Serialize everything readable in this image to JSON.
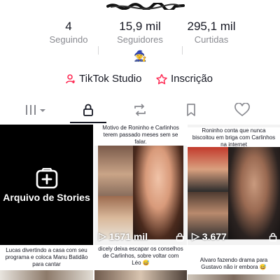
{
  "profile": {
    "stats": [
      {
        "value": "4",
        "label": "Seguindo"
      },
      {
        "value": "15,9 mil",
        "label": "Seguidores"
      },
      {
        "value": "295,1 mil",
        "label": "Curtidas"
      }
    ],
    "bio_emoji": "🧙"
  },
  "links": {
    "studio": "TikTok Studio",
    "subscription": "Inscrição"
  },
  "tabs": [
    "videos-grid",
    "private",
    "reposts",
    "saved",
    "liked"
  ],
  "active_tab": "private",
  "grid": {
    "stories_label": "Arquivo de Stories",
    "videos": [
      {
        "caption": "Motivo de Roninho e Carlinhos terem passado meses sem se falar.",
        "views": "1571 mil"
      },
      {
        "caption": "Roninho conta que nunca biscoitou em briga com Carlinhos na internet",
        "views": "3.677"
      }
    ],
    "bottom_captions": [
      "Lucas divertindo a casa com seu programa e coloca Manu Batidão para cantar",
      "dicely deixa escapar os conselhos de Carlinhos, sobre voltar com Léo 😅",
      "Alvaro fazendo drama para Gustavo não ir embora 😅"
    ]
  },
  "colors": {
    "text": "#161823",
    "muted": "#8a8b91",
    "accent": "#fe2c55"
  }
}
